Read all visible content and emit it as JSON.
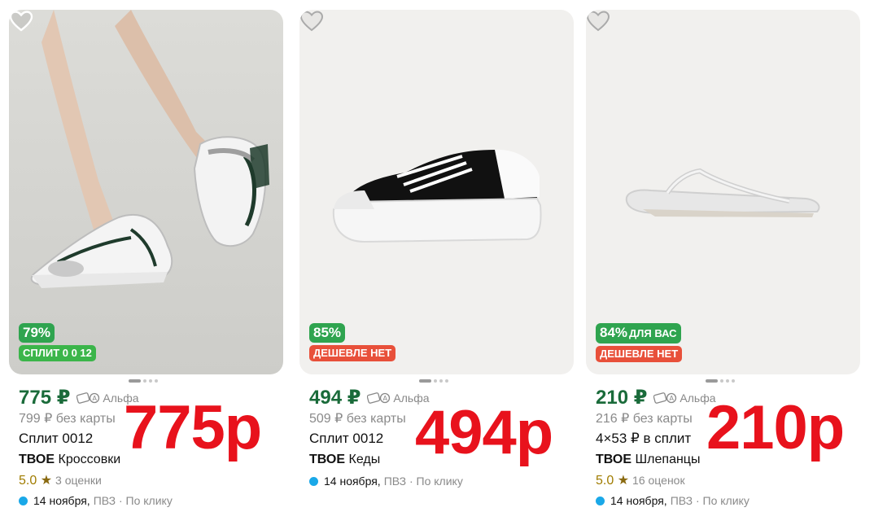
{
  "colors": {
    "discount_green": "#2fa44f",
    "no_cheaper_red": "#e8503a",
    "price_green": "#1a6b3a",
    "overlay_red": "#e8121c",
    "delivery_dot": "#1aa8e8"
  },
  "products": [
    {
      "discount": "79%",
      "discount_extra": "",
      "sub_badge": "СПЛИТ 0 0 12",
      "price": "775 ₽",
      "alfa_label": "Альфа",
      "old_price": "799 ₽ без карты",
      "split_text": "Сплит 0012",
      "brand": "ТВОЕ",
      "name": "Кроссовки",
      "rating": "5.0",
      "rating_count": "3 оценки",
      "delivery_date": "14 ноября,",
      "delivery_place": "ПВЗ · По клику",
      "overlay_price": "775р",
      "icon": "heart-icon"
    },
    {
      "discount": "85%",
      "discount_extra": "",
      "sub_badge": "ДЕШЕВЛЕ НЕТ",
      "price": "494 ₽",
      "alfa_label": "Альфа",
      "old_price": "509 ₽ без карты",
      "split_text": "Сплит 0012",
      "brand": "ТВОЕ",
      "name": "Кеды",
      "delivery_date": "14 ноября,",
      "delivery_place": "ПВЗ · По клику",
      "overlay_price": "494р",
      "icon": "heart-icon"
    },
    {
      "discount": "84%",
      "discount_extra": "ДЛЯ ВАС",
      "sub_badge": "ДЕШЕВЛЕ НЕТ",
      "price": "210 ₽",
      "alfa_label": "Альфа",
      "old_price": "216 ₽ без карты",
      "split_text": "4×53 ₽ в сплит",
      "brand": "ТВОЕ",
      "name": "Шлепанцы",
      "rating": "5.0",
      "rating_count": "16 оценок",
      "delivery_date": "14 ноября,",
      "delivery_place": "ПВЗ · По клику",
      "overlay_price": "210р",
      "icon": "heart-icon"
    }
  ]
}
